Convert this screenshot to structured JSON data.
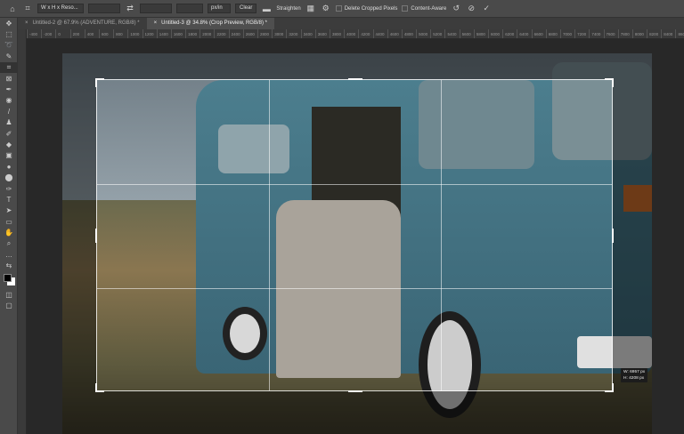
{
  "options_bar": {
    "home_icon": "home-icon",
    "crop_icon": "crop-icon",
    "ratio_preset": "W x H x Reso...",
    "width_value": "",
    "height_value": "",
    "resolution_value": "",
    "resolution_unit": "px/in",
    "clear_label": "Clear",
    "straighten_label": "Straighten",
    "delete_cropped_label": "Delete Cropped Pixels",
    "delete_cropped_checked": false,
    "content_aware_label": "Content-Aware",
    "content_aware_checked": false
  },
  "tabs": [
    {
      "label": "Untitled-2 @ 67.9% (ADVENTURE, RGB/8) *",
      "active": false
    },
    {
      "label": "Untitled-3 @ 34.8% (Crop Preview, RGB/8) *",
      "active": true
    }
  ],
  "ruler_labels": [
    "-400",
    "-200",
    "0",
    "200",
    "400",
    "600",
    "800",
    "1000",
    "1200",
    "1400",
    "1600",
    "1800",
    "2000",
    "2200",
    "2400",
    "2600",
    "2800",
    "3000",
    "3200",
    "3400",
    "3600",
    "3800",
    "4000",
    "4200",
    "4400",
    "4600",
    "4800",
    "5000",
    "5200",
    "5400",
    "5600",
    "5800",
    "6000",
    "6200",
    "6400",
    "6600",
    "6800",
    "7000",
    "7200",
    "7400",
    "7600",
    "7800",
    "8000",
    "8200",
    "8400",
    "8600"
  ],
  "tools": [
    "move",
    "marquee",
    "lasso",
    "quick-select",
    "crop",
    "frame",
    "eyedropper",
    "healing",
    "brush",
    "stamp",
    "history-brush",
    "eraser",
    "gradient",
    "blur",
    "dodge",
    "pen",
    "type",
    "path-select",
    "rectangle",
    "hand",
    "zoom",
    "more",
    "swap-colors",
    "colors",
    "quick-mask",
    "screen-mode"
  ],
  "colors": {
    "foreground": "#000000",
    "background": "#ffffff",
    "van": "#3f6f80"
  },
  "crop_readout": {
    "width": "W: 6957 px",
    "height": "H: 4208 px"
  }
}
